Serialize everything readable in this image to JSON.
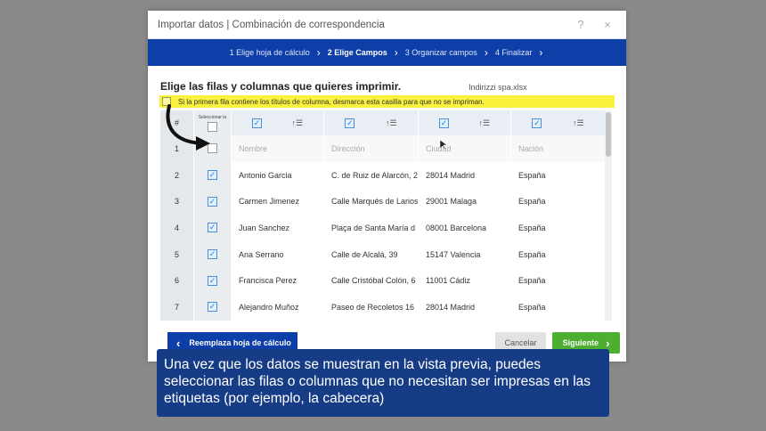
{
  "dialog": {
    "title": "Importar datos | Combinación de correspondencia",
    "help_icon": "?",
    "close_icon": "×"
  },
  "steps": [
    {
      "label": "1 Elige hoja de cálculo",
      "active": false
    },
    {
      "label": "2 Elige Campos",
      "active": true
    },
    {
      "label": "3 Organizar campos",
      "active": false
    },
    {
      "label": "4 Finalizar",
      "active": false
    }
  ],
  "heading": "Elige las filas y columnas que quieres imprimir.",
  "filename": "Indirizzi spa.xlsx",
  "header_notice": "Si la primera fila contiene los títulos de columna, desmarca esta casilla para que no se impriman.",
  "table": {
    "num_header": "#",
    "select_header": "Seleccionar la",
    "rows": [
      {
        "num": "1",
        "checked": false,
        "a": "Nombre",
        "b": "Dirección",
        "c": "Ciudad",
        "d": "Nación",
        "placeholder": true
      },
      {
        "num": "2",
        "checked": true,
        "a": "Antonio Garcia",
        "b": "C. de Ruiz de Alarcón, 2",
        "c": "28014 Madrid",
        "d": "España"
      },
      {
        "num": "3",
        "checked": true,
        "a": "Carmen Jimenez",
        "b": "Calle Marqués de Larios",
        "c": "29001 Malaga",
        "d": "España"
      },
      {
        "num": "4",
        "checked": true,
        "a": "Juan Sanchez",
        "b": "Plaça de Santa María d",
        "c": "08001 Barcelona",
        "d": "España"
      },
      {
        "num": "5",
        "checked": true,
        "a": "Ana Serrano",
        "b": "Calle de Alcalá, 39",
        "c": "15147 Valencia",
        "d": "España"
      },
      {
        "num": "6",
        "checked": true,
        "a": "Francisca Perez",
        "b": "Calle Cristóbal Colón, 6",
        "c": "11001 Cádiz",
        "d": "España"
      },
      {
        "num": "7",
        "checked": true,
        "a": "Alejandro Muñoz",
        "b": "Paseo de Recoletos 16",
        "c": "28014 Madrid",
        "d": "España"
      }
    ]
  },
  "footer": {
    "replace_label": "Reemplaza hoja de cálculo",
    "cancel_label": "Cancelar",
    "next_label": "Siguiente"
  },
  "caption": "Una vez que los datos se muestran en la vista previa, puedes seleccionar las filas o columnas que  no necesitan ser impresas en las etiquetas (por ejemplo, la cabecera)",
  "colors": {
    "brand_blue": "#0e3ea8",
    "highlight_yellow": "#f9f13c",
    "next_green": "#4caf2f",
    "caption_bg": "#173c86"
  }
}
